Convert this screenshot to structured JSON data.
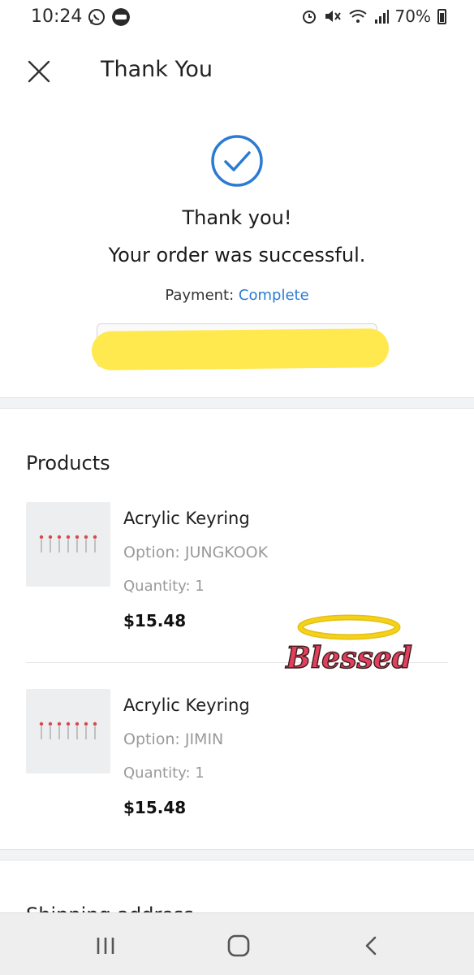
{
  "status_bar": {
    "time": "10:24",
    "battery": "70%",
    "icons": [
      "whatsapp-icon",
      "line-icon",
      "alarm-icon",
      "mute-icon",
      "wifi-icon",
      "signal-icon",
      "battery-icon"
    ]
  },
  "header": {
    "title": "Thank You",
    "close_icon": "close-icon"
  },
  "confirmation": {
    "icon": "check-circle-icon",
    "line1": "Thank you!",
    "line2": "Your order was successful.",
    "payment_label": "Payment:",
    "payment_status": "Complete"
  },
  "products": {
    "title": "Products",
    "items": [
      {
        "name": "Acrylic Keyring",
        "option": "Option: JUNGKOOK",
        "quantity": "Quantity: 1",
        "price": "$15.48"
      },
      {
        "name": "Acrylic Keyring",
        "option": "Option: JIMIN",
        "quantity": "Quantity: 1",
        "price": "$15.48"
      }
    ]
  },
  "sticker": {
    "text": "Blessed"
  },
  "next_section": {
    "title": "Shipping address"
  },
  "colors": {
    "accent": "#2b7bd3",
    "highlight": "#ffe94f",
    "sticker_text": "#e0405e",
    "halo": "#f4d21a"
  },
  "nav_bar": {
    "recent_icon": "recent-apps-icon",
    "home_icon": "home-icon",
    "back_icon": "back-icon"
  }
}
